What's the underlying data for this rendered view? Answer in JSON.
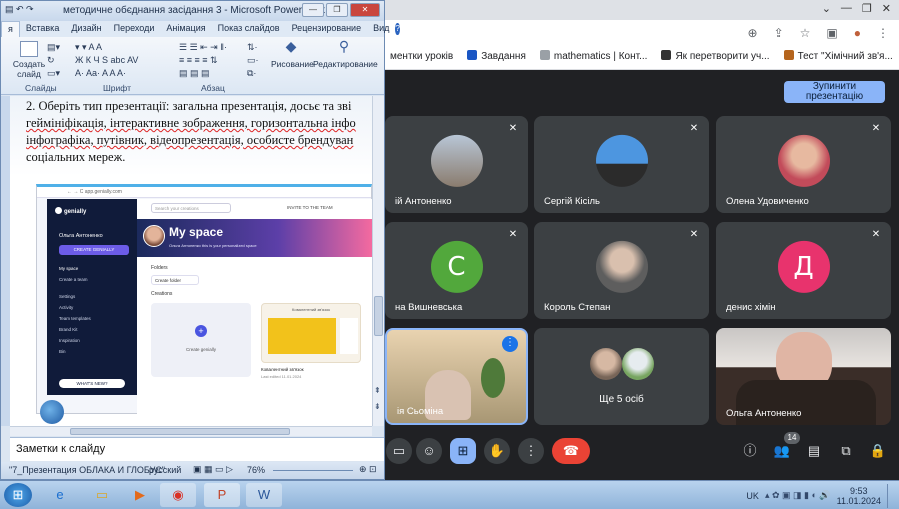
{
  "browser": {
    "bookmarks": [
      {
        "label": "ментки уроків",
        "color": "#f0f0f0"
      },
      {
        "label": "Завдання",
        "color": "#1a56c4"
      },
      {
        "label": "mathematics | Конт...",
        "color": "#7a7a7a"
      },
      {
        "label": "Як перетворити уч...",
        "color": "#333333"
      },
      {
        "label": "Тест \"Хімічний зв'я...",
        "color": "#b5651d"
      }
    ]
  },
  "meet": {
    "stop_presenting": "Зупинити презентацію",
    "tiles": [
      {
        "name": "ій Антоненко",
        "avatar_type": "photo",
        "avatar_color": "#8a7c6e"
      },
      {
        "name": "Сергій Кісіль",
        "avatar_type": "photo",
        "avatar_color": "#3a7fd1"
      },
      {
        "name": "Олена Удовиченко",
        "avatar_type": "photo",
        "avatar_color": "#c97a86"
      },
      {
        "name": "на Вишневська",
        "avatar_type": "letter",
        "letter": "С",
        "avatar_color": "#52a83c"
      },
      {
        "name": "Король Степан",
        "avatar_type": "photo",
        "avatar_color": "#6b6b6b"
      },
      {
        "name": "денис хімін",
        "avatar_type": "letter",
        "letter": "Д",
        "avatar_color": "#e8336d"
      },
      {
        "name": "ія Сьоміна",
        "avatar_type": "video",
        "avatar_color": "#b5a78c"
      },
      {
        "name": "Ще 5 осіб",
        "avatar_type": "group",
        "avatar_color": "#555555"
      },
      {
        "name": "Ольга Антоненко",
        "avatar_type": "video",
        "avatar_color": "#40342e"
      }
    ],
    "participant_count": "14"
  },
  "powerpoint": {
    "title": "методичне обєднання засідання 3 - Microsoft PowerPoint",
    "tabs": [
      "я",
      "Вставка",
      "Дизайн",
      "Переходи",
      "Анімация",
      "Показ слайдов",
      "Рецензирование",
      "Вид"
    ],
    "ribbon": {
      "create_slide": "Создать слайд",
      "drawing": "Рисование",
      "editing": "Редактирование",
      "groups": [
        "Слайды",
        "Шрифт",
        "Абзац"
      ]
    },
    "slide_text": {
      "line1": "2. Оберіть тип презентації: загальна презентація, досьє та зві",
      "line2": "геймініфікація, інтерактивне зображення, горизонтальна інфо",
      "line3": "інфографіка, путівник, відеопрезентація, особисте брендуван",
      "line4": "соціальних мереж."
    },
    "notes": "Заметки к слайду",
    "status": {
      "slide_info": "\"7_Презентация ОБЛАКА И ГЛОБУС\"",
      "language": "русский",
      "zoom": "76%"
    },
    "embedded": {
      "brand": "genially",
      "user": "Ольга Антоненко",
      "create_btn": "CREATE GENIALLY",
      "nav": [
        "My space",
        "Create a team",
        "Settings",
        "Activity",
        "Team templates",
        "Brand Kit",
        "Inspiration",
        "Bin"
      ],
      "hero": "My space",
      "hero_sub": "Ольга Антоненко  this is your personalized space",
      "search": "Search your creations",
      "invite": "INVITE TO THE TEAM",
      "folders_label": "Folders",
      "folder_name": "Create folder",
      "creations_label": "Creations",
      "create_card": "Create genially",
      "card_title": "Ковалентний зв'язок",
      "card_sub": "Ковалентний зв'язок",
      "card_meta": "Last edited 11.01.2024",
      "whats_new": "WHAT'S NEW?"
    }
  },
  "taskbar": {
    "lang": "UK",
    "time": "9:53",
    "date": "11.01.2024"
  }
}
